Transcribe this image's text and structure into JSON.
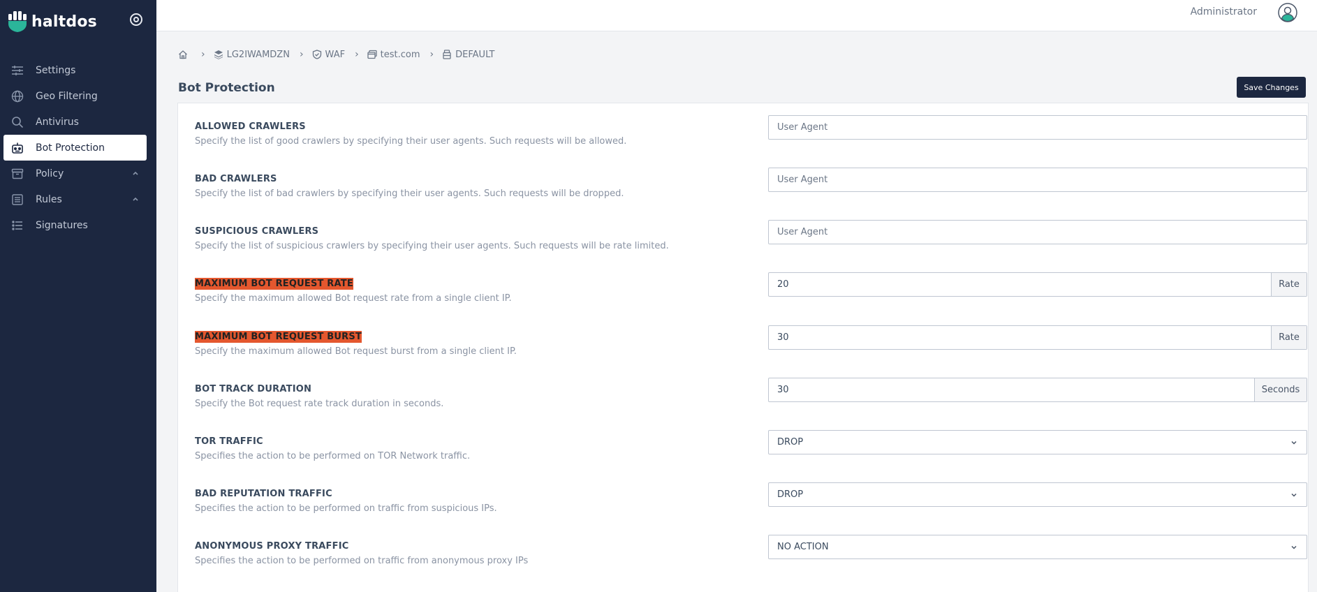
{
  "brand": {
    "name": "haltdos"
  },
  "sidebar": {
    "items": [
      {
        "label": "Settings",
        "icon": "sliders-icon"
      },
      {
        "label": "Geo Filtering",
        "icon": "globe-icon"
      },
      {
        "label": "Antivirus",
        "icon": "search-icon"
      },
      {
        "label": "Bot Protection",
        "icon": "robot-icon",
        "active": true
      },
      {
        "label": "Policy",
        "icon": "archive-icon",
        "expandable": true
      },
      {
        "label": "Rules",
        "icon": "list-box-icon",
        "expandable": true
      },
      {
        "label": "Signatures",
        "icon": "list-icon"
      }
    ]
  },
  "topbar": {
    "user": "Administrator"
  },
  "breadcrumb": [
    {
      "label": "",
      "icon": "home-icon"
    },
    {
      "label": "LG2IWAMDZN",
      "icon": "layers-icon"
    },
    {
      "label": "WAF",
      "icon": "shield-icon"
    },
    {
      "label": "test.com",
      "icon": "window-icon"
    },
    {
      "label": "DEFAULT",
      "icon": "server-icon"
    }
  ],
  "page": {
    "title": "Bot Protection",
    "save_label": "Save Changes"
  },
  "settings": [
    {
      "title": "ALLOWED CRAWLERS",
      "desc": "Specify the list of good crawlers by specifying their user agents. Such requests will be allowed.",
      "type": "text",
      "placeholder": "User Agent"
    },
    {
      "title": "BAD CRAWLERS",
      "desc": "Specify the list of bad crawlers by specifying their user agents. Such requests will be dropped.",
      "type": "text",
      "placeholder": "User Agent"
    },
    {
      "title": "SUSPICIOUS CRAWLERS",
      "desc": "Specify the list of suspicious crawlers by specifying their user agents. Such requests will be rate limited.",
      "type": "text",
      "placeholder": "User Agent"
    },
    {
      "title": "MAXIMUM BOT REQUEST RATE",
      "desc": "Specify the maximum allowed Bot request rate from a single client IP.",
      "type": "number",
      "value": "20",
      "addon": "Rate",
      "highlight": true
    },
    {
      "title": "MAXIMUM BOT REQUEST BURST",
      "desc": "Specify the maximum allowed Bot request burst from a single client IP.",
      "type": "number",
      "value": "30",
      "addon": "Rate",
      "highlight": true
    },
    {
      "title": "BOT TRACK DURATION",
      "desc": "Specify the Bot request rate track duration in seconds.",
      "type": "number",
      "value": "30",
      "addon": "Seconds"
    },
    {
      "title": "TOR TRAFFIC",
      "desc": "Specifies the action to be performed on TOR Network traffic.",
      "type": "select",
      "value": "DROP"
    },
    {
      "title": "BAD REPUTATION TRAFFIC",
      "desc": "Specifies the action to be performed on traffic from suspicious IPs.",
      "type": "select",
      "value": "DROP"
    },
    {
      "title": "ANONYMOUS PROXY TRAFFIC",
      "desc": "Specifies the action to be performed on traffic from anonymous proxy IPs",
      "type": "select",
      "value": "NO ACTION"
    }
  ],
  "colors": {
    "sidebar": "#1c2740",
    "highlight": "#e4572e",
    "accent_avatar": "#2bb59a"
  }
}
